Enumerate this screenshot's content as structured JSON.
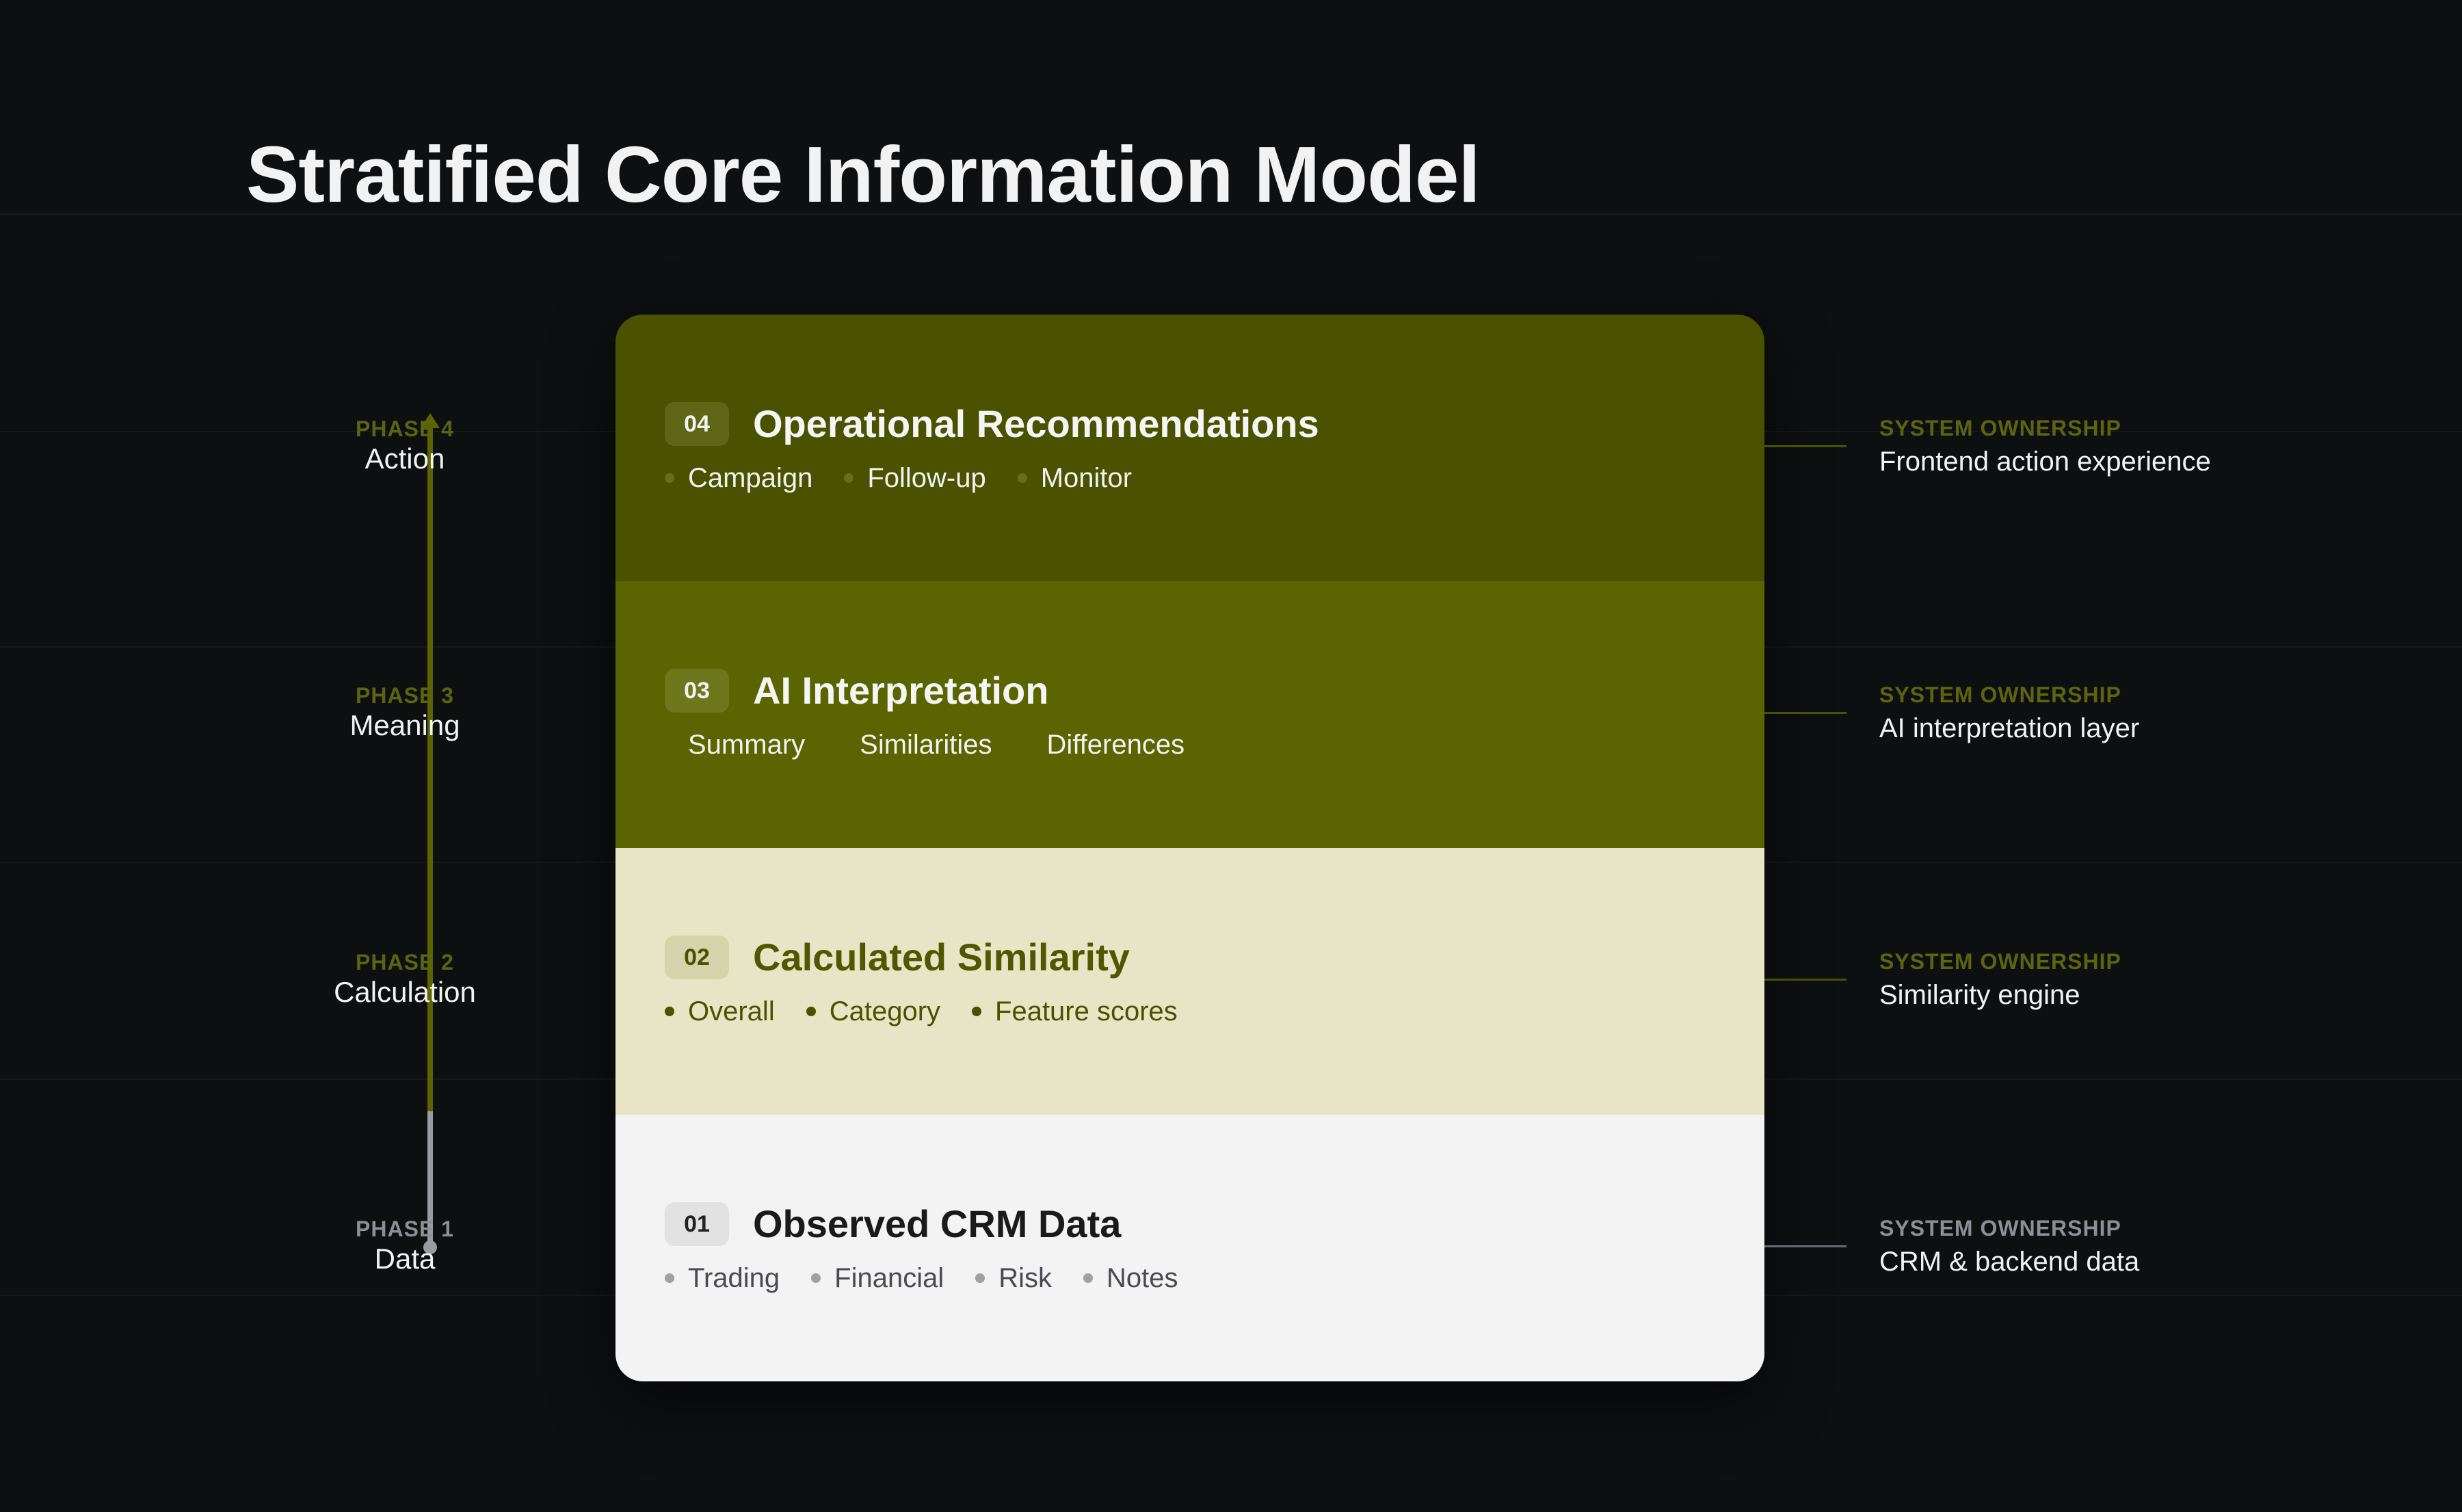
{
  "title": "Stratified Core Information Model",
  "colors": {
    "background": "#0e0f11",
    "olive_dark": "#4a5200",
    "olive": "#5a6400",
    "cream": "#e8e5c6",
    "light": "#f3f3f3",
    "olive_label": "#6b7412",
    "grey_label": "#9a9aa2"
  },
  "phases": [
    {
      "label": "PHASE 4",
      "name": "Action"
    },
    {
      "label": "PHASE 3",
      "name": "Meaning"
    },
    {
      "label": "PHASE 2",
      "name": "Calculation"
    },
    {
      "label": "PHASE 1",
      "name": "Data"
    }
  ],
  "layers": [
    {
      "number": "04",
      "title": "Operational Recommendations",
      "items": [
        "Campaign",
        "Follow-up",
        "Monitor"
      ]
    },
    {
      "number": "03",
      "title": "AI Interpretation",
      "items": [
        "Summary",
        "Similarities",
        "Differences"
      ]
    },
    {
      "number": "02",
      "title": "Calculated Similarity",
      "items": [
        "Overall",
        "Category",
        "Feature scores"
      ]
    },
    {
      "number": "01",
      "title": "Observed CRM Data",
      "items": [
        "Trading",
        "Financial",
        "Risk",
        "Notes"
      ]
    }
  ],
  "ownership": [
    {
      "label": "SYSTEM OWNERSHIP",
      "value": "Frontend action experience"
    },
    {
      "label": "SYSTEM OWNERSHIP",
      "value": "AI interpretation layer"
    },
    {
      "label": "SYSTEM OWNERSHIP",
      "value": "Similarity engine"
    },
    {
      "label": "SYSTEM OWNERSHIP",
      "value": "CRM & backend data"
    }
  ]
}
